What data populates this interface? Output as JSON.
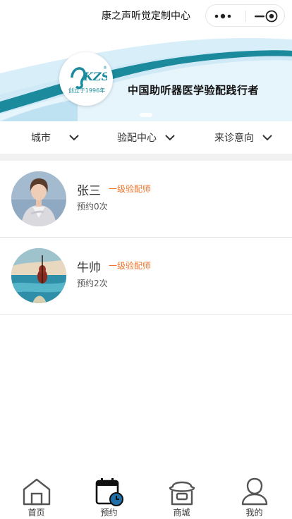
{
  "app": {
    "title": "康之声听觉定制中心"
  },
  "banner": {
    "logo_text": "KZS",
    "logo_established": "创立于1996年",
    "slogan": "中国助听器医学验配践行者"
  },
  "filters": [
    {
      "label": "城市"
    },
    {
      "label": "验配中心"
    },
    {
      "label": "来诊意向"
    }
  ],
  "fitters": [
    {
      "name": "张三",
      "level": "一级验配师",
      "appointments": "预约0次"
    },
    {
      "name": "牛帅",
      "level": "一级验配师",
      "appointments": "预约2次"
    }
  ],
  "tabbar": [
    {
      "label": "首页",
      "icon": "home-icon"
    },
    {
      "label": "预约",
      "icon": "calendar-clock-icon",
      "active": true
    },
    {
      "label": "商城",
      "icon": "store-icon"
    },
    {
      "label": "我的",
      "icon": "user-icon"
    }
  ],
  "colors": {
    "accent": "#f0732a",
    "brand_teal": "#1a8a9c",
    "banner_blue": "#cfe9f7"
  }
}
